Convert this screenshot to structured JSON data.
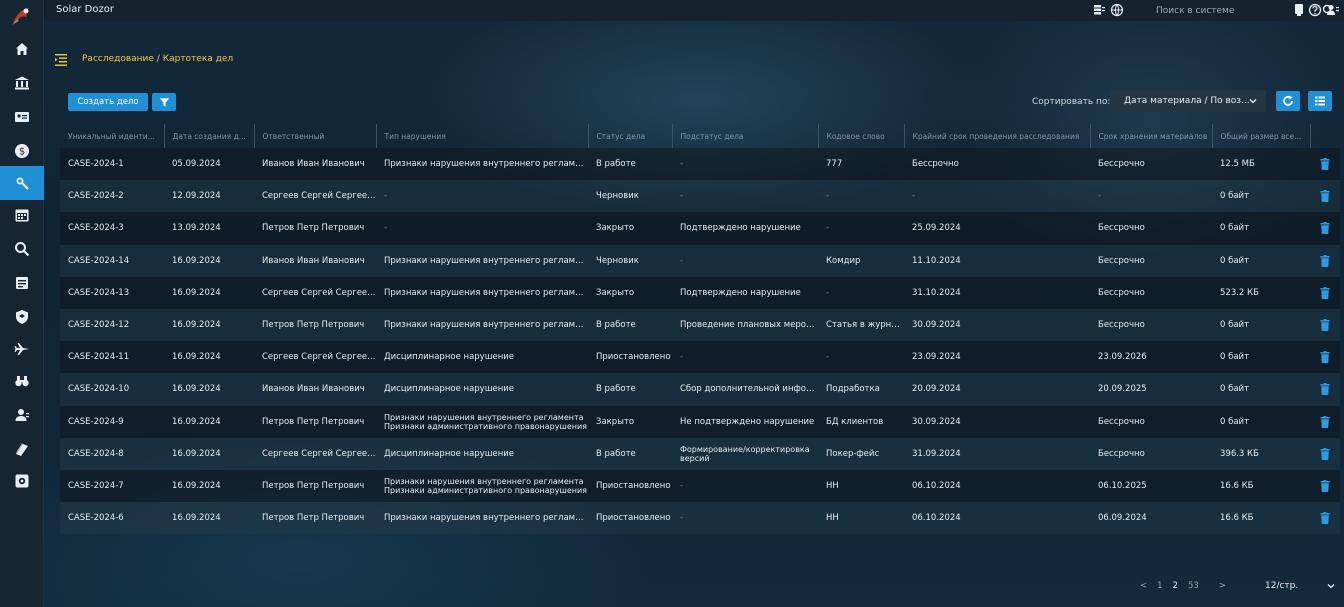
{
  "app": {
    "title": "Solar Dozor",
    "search_placeholder": "Поиск в системе"
  },
  "breadcrumb": "Расследование / Картотека дел",
  "toolbar": {
    "create_label": "Создать дело",
    "sort_label": "Сортировать по:",
    "sort_value": "Дата материала / По воз..."
  },
  "colors": {
    "accent": "#1f8fd6",
    "breadcrumb": "#f2c94c",
    "trash": "#2b9be3"
  },
  "sidebar": {
    "items": [
      "home-icon",
      "bank-icon",
      "id-card-icon",
      "dollar-icon",
      "investigation-icon",
      "calendar-icon",
      "search-icon",
      "document-icon",
      "shield-icon",
      "plane-icon",
      "binoculars-icon",
      "user-icon",
      "book-icon",
      "gear-icon"
    ],
    "active_index": 4
  },
  "table": {
    "headers": [
      "Уникальный иденти...",
      "Дата создания д...",
      "Ответственный",
      "Тип нарушения",
      "Статус дела",
      "Подстатус дела",
      "Кодовое слово",
      "Крайний срок проведения расследования",
      "Срок хранения материалов",
      "Общий размер все...",
      ""
    ],
    "rows": [
      [
        "CASE-2024-1",
        "05.09.2024",
        "Иванов Иван Иванович",
        "Признаки нарушения внутреннего регламента",
        "В работе",
        "-",
        "777",
        "Бессрочно",
        "Бессрочно",
        "12.5 МБ"
      ],
      [
        "CASE-2024-2",
        "12.09.2024",
        "Сергеев Сергей Сергеевич",
        "-",
        "Черновик",
        "-",
        "-",
        "-",
        "-",
        "0 байт"
      ],
      [
        "CASE-2024-3",
        "13.09.2024",
        "Петров Петр Петрович",
        "-",
        "Закрыто",
        "Подтверждено нарушение",
        "-",
        "25.09.2024",
        "Бессрочно",
        "0 байт"
      ],
      [
        "CASE-2024-14",
        "16.09.2024",
        "Иванов Иван Иванович",
        "Признаки нарушения внутреннего регламента",
        "Черновик",
        "-",
        "Комдир",
        "11.10.2024",
        "Бессрочно",
        "0 байт"
      ],
      [
        "CASE-2024-13",
        "16.09.2024",
        "Сергеев Сергей Сергеевич",
        "Признаки нарушения внутреннего регламента",
        "Закрыто",
        "Подтверждено нарушение",
        "-",
        "31.10.2024",
        "Бессрочно",
        "523.2 КБ"
      ],
      [
        "CASE-2024-12",
        "16.09.2024",
        "Петров Петр Петрович",
        "Признаки нарушения внутреннего регламента",
        "В работе",
        "Проведение плановых меропри",
        "Статья в журнале",
        "30.09.2024",
        "Бессрочно",
        "0 байт"
      ],
      [
        "CASE-2024-11",
        "16.09.2024",
        "Сергеев Сергей Сергеевич",
        "Дисциплинарное нарушение",
        "Приостановлено",
        "-",
        "-",
        "23.09.2024",
        "23.09.2026",
        "0 байт"
      ],
      [
        "CASE-2024-10",
        "16.09.2024",
        "Иванов Иван Иванович",
        "Дисциплинарное нарушение",
        "В работе",
        "Сбор дополнительной информа",
        "Подработка",
        "20.09.2024",
        "20.09.2025",
        "0 байт"
      ],
      [
        "CASE-2024-9",
        "16.09.2024",
        "Петров Петр Петрович",
        "Признаки нарушения внутреннего регламента Признаки административного правонарушения",
        "Закрыто",
        "Не подтверждено нарушение",
        "БД клиентов",
        "30.09.2024",
        "Бессрочно",
        "0 байт"
      ],
      [
        "CASE-2024-8",
        "16.09.2024",
        "Сергеев Сергей Сергеевич",
        "Дисциплинарное нарушение",
        "В работе",
        "Формирование/корректировка версий",
        "Покер-фейс",
        "31.09.2024",
        "Бессрочно",
        "396.3 КБ"
      ],
      [
        "CASE-2024-7",
        "16.09.2024",
        "Петров Петр Петрович",
        "Признаки нарушения внутреннего регламента Признаки административного правонарушения",
        "Приостановлено",
        "-",
        "НН",
        "06.10.2024",
        "06.10.2025",
        "16.6 КБ"
      ],
      [
        "CASE-2024-6",
        "16.09.2024",
        "Петров Петр Петрович",
        "Признаки нарушения внутреннего регламента",
        "Приостановлено",
        "-",
        "НН",
        "06.10.2024",
        "06.09.2024",
        "16.6 КБ"
      ]
    ]
  },
  "pagination": {
    "pages": [
      "1",
      "2",
      "53"
    ],
    "current": "2",
    "page_size": "12/стр."
  }
}
